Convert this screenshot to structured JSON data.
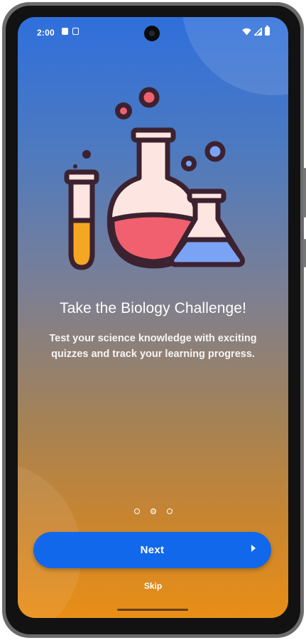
{
  "status_bar": {
    "time": "2:00",
    "left_icons": [
      "sim-card-icon",
      "message-icon"
    ],
    "right_icons": [
      "wifi-icon",
      "signal-icon",
      "battery-icon"
    ]
  },
  "onboarding": {
    "illustration_icon": "lab-flasks-illustration",
    "title": "Take the Biology Challenge!",
    "description": "Test your science knowledge with exciting quizzes and track your learning progress.",
    "page_count": 3,
    "active_page": 2
  },
  "actions": {
    "next_label": "Next",
    "next_icon": "chevron-right-icon",
    "skip_label": "Skip"
  },
  "colors": {
    "gradient_top": "#2f6fdc",
    "gradient_bottom": "#e98e16",
    "primary_button": "#1268ea",
    "flask_liquid_red": "#f0606e",
    "flask_liquid_blue": "#7ba3f5",
    "tube_liquid": "#f5a623",
    "glass": "#fde6e1",
    "outline": "#3c2230"
  }
}
